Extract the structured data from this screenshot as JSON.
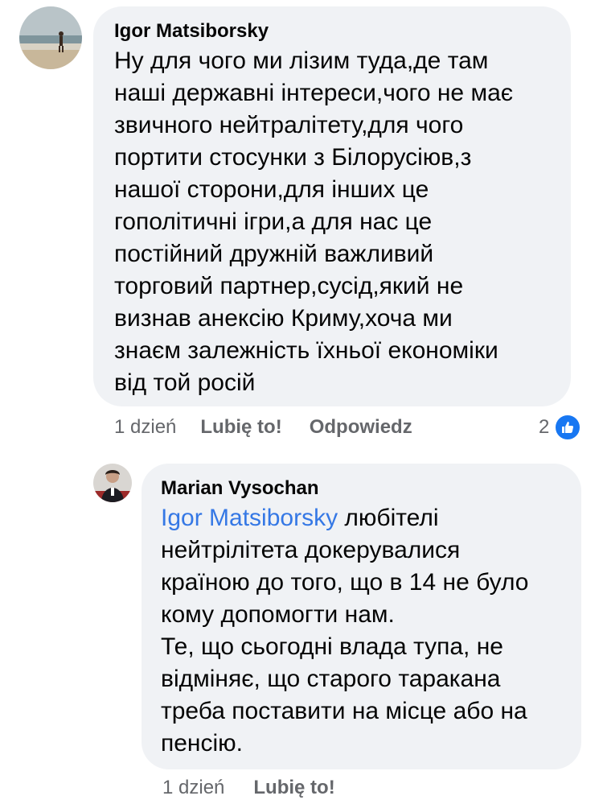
{
  "comments": [
    {
      "author": "Igor Matsiborsky",
      "text": "Ну для чого ми лізим туда,де там\nнаші державні інтереси,чого не має\nзвичного нейтралітету,для чого\nпортити стосунки з Білорусіюв,з\nнашої сторони,для інших це\nгополітичні ігри,а для нас це\nпостійний дружній важливий\nторговий партнер,сусід,який не\nвизнав анексію Криму,хоча ми\nзнаєм залежність їхньої економіки\nвід той росій",
      "time": "1 dzień",
      "like_label": "Lubię to!",
      "reply_label": "Odpowiedz",
      "reaction_count": "2",
      "reaction_icon": "like-icon"
    },
    {
      "author": "Marian Vysochan",
      "mention": "Igor Matsiborsky",
      "text": " любітелі\nнейтрілітета докерувалися\nкраїною до того, що в 14 не було\nкому допомогти нам.\nТе, що сьогодні влада тупа, не\nвідміняє, що старого таракана\nтреба поставити на місце або на\nпенсію.",
      "time": "1 dzień",
      "like_label": "Lubię to!"
    }
  ],
  "colors": {
    "bubble": "#f0f2f5",
    "mention": "#3578e5",
    "meta": "#65676b",
    "like_badge": "#1877f2"
  }
}
